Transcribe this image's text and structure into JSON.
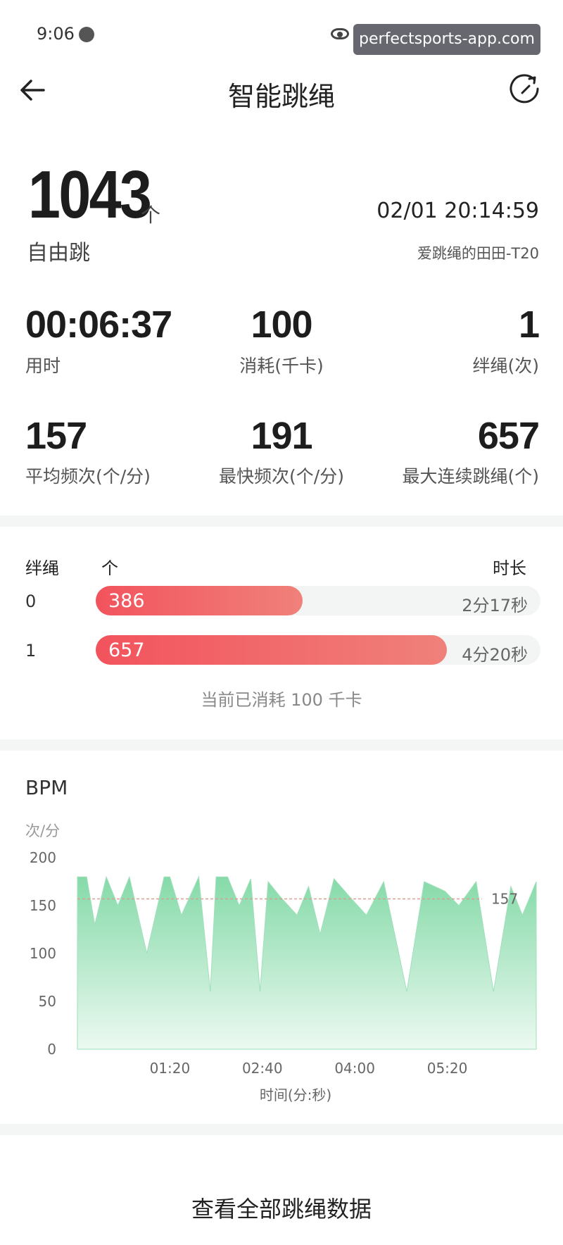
{
  "status_bar": {
    "time": "9:06",
    "watermark": "perfectsports-app.com"
  },
  "header": {
    "title": "智能跳绳"
  },
  "summary": {
    "count": "1043",
    "count_unit": "个",
    "mode": "自由跳",
    "datetime": "02/01 20:14:59",
    "device": "爱跳绳的田田-T20"
  },
  "stats": [
    {
      "value": "00:06:37",
      "label": "用时"
    },
    {
      "value": "100",
      "label": "消耗(千卡)"
    },
    {
      "value": "1",
      "label": "绊绳(次)"
    },
    {
      "value": "157",
      "label": "平均频次(个/分)"
    },
    {
      "value": "191",
      "label": "最快频次(个/分)"
    },
    {
      "value": "657",
      "label": "最大连续跳绳(个)"
    }
  ],
  "segments": {
    "col_trip": "绊绳",
    "col_count": "个",
    "col_duration": "时长",
    "rows": [
      {
        "trip": "0",
        "count": "386",
        "duration": "2分17秒",
        "fill": 0.465
      },
      {
        "trip": "1",
        "count": "657",
        "duration": "4分20秒",
        "fill": 0.79
      }
    ],
    "note": "当前已消耗 100 千卡"
  },
  "chart": {
    "title": "BPM",
    "unit": "次/分",
    "avg_label": "157"
  },
  "chart_data": {
    "type": "area",
    "ylabel": "次/分",
    "xlabel": "时间(分:秒)",
    "ylim": [
      0,
      200
    ],
    "yticks": [
      "200",
      "150",
      "100",
      "50",
      "0"
    ],
    "xticks": [
      "01:20",
      "02:40",
      "04:00",
      "05:20"
    ],
    "average": 157,
    "duration_seconds": 397,
    "series": [
      {
        "color": "#7fd8a4",
        "x_seconds": [
          0,
          8,
          15,
          25,
          35,
          45,
          60,
          75,
          80,
          90,
          105,
          115,
          120,
          130,
          140,
          150,
          158,
          165,
          175,
          190,
          200,
          210,
          222,
          235,
          250,
          265,
          285,
          300,
          318,
          330,
          345,
          360,
          375,
          385,
          397
        ],
        "values": [
          180,
          180,
          130,
          180,
          150,
          180,
          100,
          180,
          180,
          140,
          180,
          60,
          180,
          180,
          150,
          178,
          60,
          175,
          160,
          140,
          170,
          120,
          178,
          160,
          140,
          175,
          60,
          175,
          165,
          150,
          175,
          60,
          170,
          140,
          175
        ]
      }
    ]
  },
  "footer": {
    "link": "查看全部跳绳数据"
  },
  "colors": {
    "accent_red": "#f2535d",
    "chart_green": "#7fd8a4",
    "avg_line": "#d8a090"
  },
  "icons": {
    "back": "back-arrow-icon",
    "refresh": "refresh-icon",
    "globe": "globe-icon",
    "eye": "eye-icon"
  }
}
